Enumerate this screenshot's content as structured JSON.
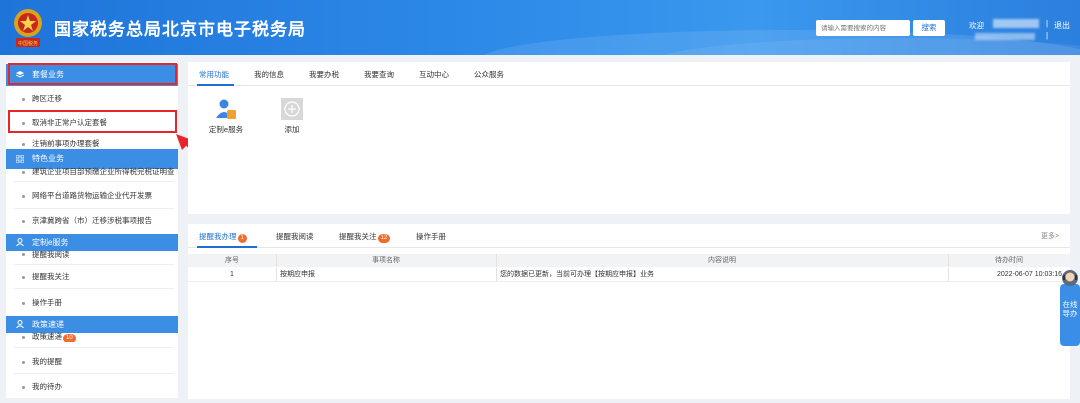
{
  "header": {
    "title": "国家税务总局北京市电子税务局",
    "emblem_text": "中国税务",
    "search_placeholder": "请输入需要搜索的内容",
    "search_button": "搜索",
    "welcome": "欢迎",
    "separator": "|",
    "logout": "退出"
  },
  "sidebar": {
    "sections": [
      {
        "title": "套餐业务",
        "icon": "layers-icon"
      },
      {
        "title": "特色业务",
        "icon": "grid-icon"
      },
      {
        "title": "定制e服务",
        "icon": "user-icon"
      },
      {
        "title": "政策速递",
        "icon": "user-icon"
      }
    ],
    "items": [
      "跨区迁移",
      "取消非正常户认定套餐",
      "注销前事项办理套餐",
      "建筑企业项目部预缴企业所得税完税证明查送",
      "网络平台道路货物运输企业代开发票",
      "京津冀跨省（市）迁移涉税事项报告",
      "提醒我阅读",
      "提醒我关注",
      "操作手册",
      "政策速递",
      "我的提醒",
      "我的待办"
    ],
    "policy_badge": "10"
  },
  "main": {
    "tabs": [
      "常用功能",
      "我的信息",
      "我要办税",
      "我要查询",
      "互动中心",
      "公众服务"
    ],
    "apps": [
      {
        "label": "定制e服务",
        "icon": "person-icon"
      },
      {
        "label": "添加",
        "icon": "plus-icon"
      }
    ]
  },
  "bottom": {
    "tabs": [
      {
        "label": "提醒我办理",
        "badge": "1"
      },
      {
        "label": "提醒我阅读",
        "badge": ""
      },
      {
        "label": "提醒我关注",
        "badge": "12"
      },
      {
        "label": "操作手册",
        "badge": ""
      }
    ],
    "more": "更多>",
    "columns": [
      "序号",
      "事项名称",
      "内容说明",
      "待办时间"
    ],
    "rows": [
      {
        "no": "1",
        "name": "按期应申报",
        "desc": "您的数据已更新，当前可办理【按期应申报】业务",
        "time": "2022-06-07 10:03:16"
      }
    ]
  },
  "widget": {
    "text": "在线导办"
  },
  "colors": {
    "brand_blue": "#1f74d9",
    "accent_blue": "#1f6fd0",
    "badge_orange": "#f36b2a",
    "annotation_red": "#e8262a"
  }
}
